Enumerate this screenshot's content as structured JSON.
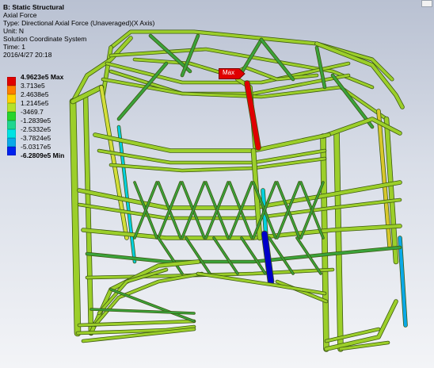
{
  "result_info": {
    "analysis": "B: Static Structural",
    "result_name": "Axial Force",
    "type": "Type: Directional Axial Force (Unaveraged)(X Axis)",
    "unit": "Unit: N",
    "coordinate_system": "Solution Coordinate System",
    "time": "Time: 1",
    "date": "2016/4/27 20:18"
  },
  "legend": {
    "entries": [
      {
        "label": "4.9623e5 Max",
        "color": "#e00000",
        "bold": true
      },
      {
        "label": "3.713e5",
        "color": "#ff7f00",
        "bold": false
      },
      {
        "label": "2.4638e5",
        "color": "#ffd200",
        "bold": false
      },
      {
        "label": "1.2145e5",
        "color": "#b4e22a",
        "bold": false
      },
      {
        "label": "-3469.7",
        "color": "#27d42b",
        "bold": false
      },
      {
        "label": "-1.2839e5",
        "color": "#1fd68f",
        "bold": false
      },
      {
        "label": "-2.5332e5",
        "color": "#00e3e3",
        "bold": false
      },
      {
        "label": "-3.7824e5",
        "color": "#0aa9e8",
        "bold": false
      },
      {
        "label": "-5.0317e5",
        "color": "#0022ee",
        "bold": false
      },
      {
        "label": "-6.2809e5 Min",
        "color": "#0000c8",
        "bold": true
      }
    ]
  },
  "max_probe": {
    "label": "Max"
  },
  "colors": {
    "background_top": "#b9c1d2",
    "background_bottom": "#f3f4f7",
    "beam_main": "#9ccf2a",
    "beam_dark": "#3aa33a",
    "beam_outline": "#3d5a12",
    "max_member": "#e00000",
    "min_member": "#0000c8"
  }
}
